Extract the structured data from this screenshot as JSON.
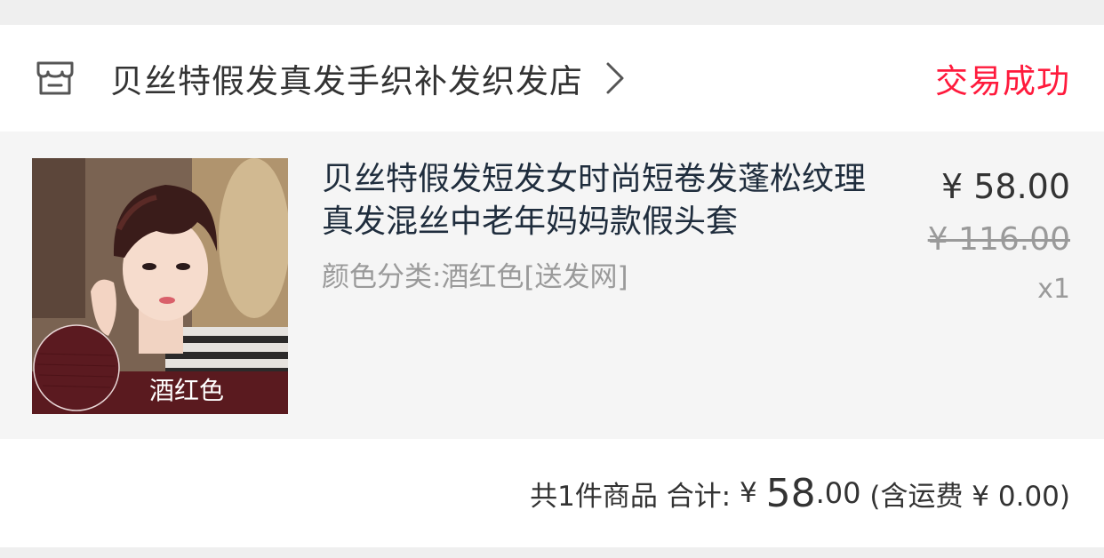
{
  "shop": {
    "name": "贝丝特假发真发手织补发织发店",
    "icon": "shop-icon",
    "chevron": "chevron-right-icon"
  },
  "order": {
    "status": "交易成功",
    "status_color": "#ff1a3c"
  },
  "item": {
    "title": "贝丝特假发短发女时尚短卷发蓬松纹理真发混丝中老年妈妈款假头套",
    "sku": "颜色分类:酒红色[送发网]",
    "thumb_caption": "酒红色",
    "price": "¥ 58.00",
    "original_price": "¥ 116.00",
    "quantity": "x1"
  },
  "summary": {
    "count_text": "共1件商品",
    "total_label": "合计:",
    "currency": "¥",
    "total_int": "58",
    "total_dec": ".00",
    "shipping": "(含运费 ¥ 0.00)"
  }
}
